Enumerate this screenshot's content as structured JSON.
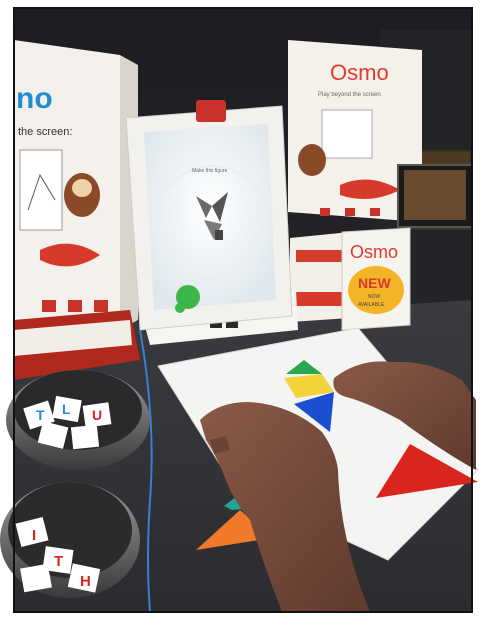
{
  "boxes": {
    "left_box_logo_fragment": "no",
    "left_box_tagline_fragment": "the screen:",
    "right_box_logo": "Osmo",
    "right_box_tagline": "Play beyond the screen"
  },
  "ipad": {
    "screen_prompt": "Make this figure"
  },
  "sign": {
    "logo": "Osmo",
    "badge": "NEW",
    "line1": "NOW",
    "line2": "AVAILABLE"
  },
  "colors": {
    "osmo_red": "#e23b2e",
    "tangram_red": "#d9251d",
    "tangram_orange": "#f07a2a",
    "tangram_blue": "#1c4fd0",
    "tangram_yellow": "#f3d33a",
    "tangram_green": "#2aa84f",
    "tangram_teal": "#23a58f"
  }
}
